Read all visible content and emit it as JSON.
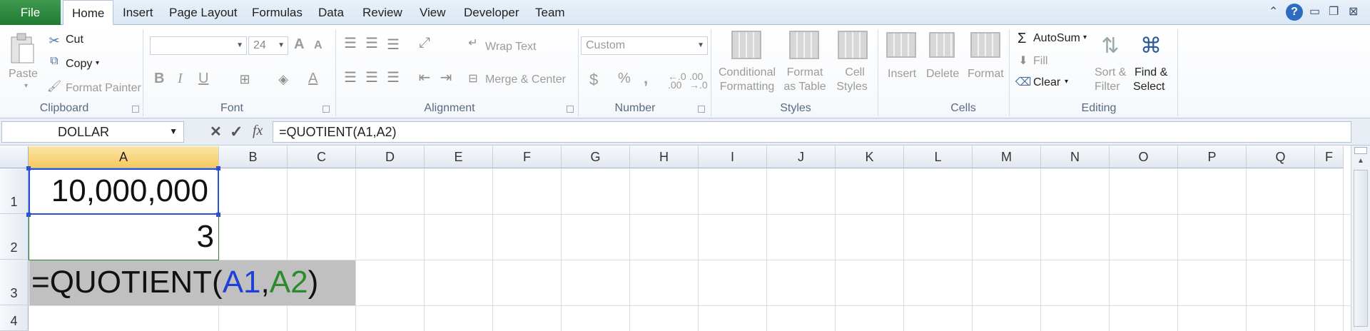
{
  "tabs": {
    "file": "File",
    "items": [
      "Home",
      "Insert",
      "Page Layout",
      "Formulas",
      "Data",
      "Review",
      "View",
      "Developer",
      "Team"
    ]
  },
  "help_glyph": "?",
  "clipboard": {
    "paste": "Paste",
    "cut": "Cut",
    "copy": "Copy",
    "format_painter": "Format Painter",
    "label": "Clipboard"
  },
  "font": {
    "name": "",
    "size": "24",
    "label": "Font",
    "bold": "B",
    "italic": "I",
    "underline": "U",
    "grow": "A",
    "shrink": "A",
    "color": "A"
  },
  "alignment": {
    "wrap_text": "Wrap Text",
    "merge_center": "Merge & Center",
    "label": "Alignment"
  },
  "number": {
    "format": "Custom",
    "currency": "$",
    "percent": "%",
    "comma": ",",
    "inc_decimal": "←.0 .00",
    "dec_decimal": ".00 →.0",
    "label": "Number"
  },
  "styles": {
    "conditional_1": "Conditional",
    "conditional_2": "Formatting",
    "format_table_1": "Format",
    "format_table_2": "as Table",
    "cell_styles_1": "Cell",
    "cell_styles_2": "Styles",
    "label": "Styles"
  },
  "cells": {
    "insert": "Insert",
    "delete": "Delete",
    "format": "Format",
    "label": "Cells"
  },
  "editing": {
    "autosum": "AutoSum",
    "fill": "Fill",
    "clear": "Clear",
    "sort_1": "Sort &",
    "sort_2": "Filter",
    "find_1": "Find &",
    "find_2": "Select",
    "label": "Editing"
  },
  "formula_bar": {
    "name_box": "DOLLAR",
    "cancel": "✕",
    "enter": "✓",
    "fx": "fx",
    "formula": "=QUOTIENT(A1,A2)"
  },
  "columns": [
    "A",
    "B",
    "C",
    "D",
    "E",
    "F",
    "G",
    "H",
    "I",
    "J",
    "K",
    "L",
    "M",
    "N",
    "O",
    "P",
    "Q",
    "F"
  ],
  "rows": [
    "1",
    "2",
    "3",
    "4"
  ],
  "cells_data": {
    "a1": "10,000,000",
    "a2": "3",
    "a3_prefix": "=QUOTIENT(",
    "a3_ref1": "A1",
    "a3_comma": ",",
    "a3_ref2": "A2",
    "a3_suffix": ")"
  },
  "colors": {
    "file_tab": "#2a8540",
    "selected_header": "#f7c960",
    "ref1": "#1f3fd6",
    "ref2": "#2c8a2c",
    "edit_cell_bg": "#c0c0c0"
  }
}
